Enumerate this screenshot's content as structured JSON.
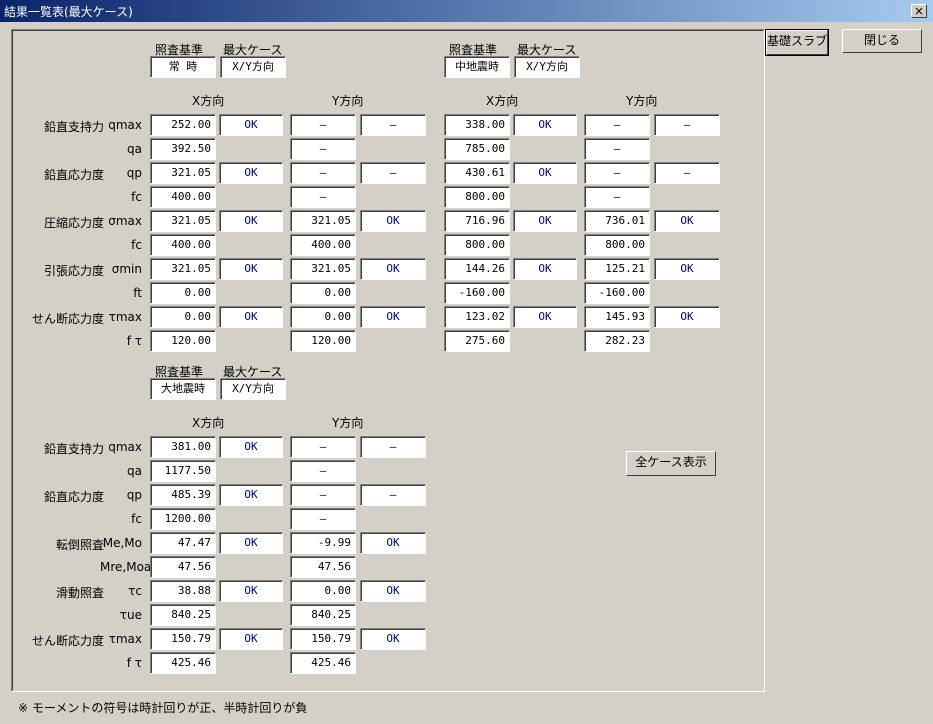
{
  "window": {
    "title": "結果一覧表(最大ケース)",
    "close_glyph": "×"
  },
  "buttons": {
    "slab": "基礎スラブ",
    "close": "閉じる",
    "all_cases": "全ケース表示"
  },
  "headers": {
    "standard": "照査基準",
    "max_case": "最大ケース",
    "x_dir": "X方向",
    "y_dir": "Y方向"
  },
  "group1": {
    "standard": "常 時",
    "max_case": "X/Y方向",
    "rows": [
      {
        "label": "鉛直支持力",
        "sym": "qmax",
        "x": "252.00",
        "xok": "OK",
        "y": "—",
        "yok": "—"
      },
      {
        "sym": "qa",
        "x": "392.50",
        "y": "—"
      },
      {
        "label": "鉛直応力度",
        "sym": "qp",
        "x": "321.05",
        "xok": "OK",
        "y": "—",
        "yok": "—"
      },
      {
        "sym": "fc",
        "x": "400.00",
        "y": "—"
      },
      {
        "label": "圧縮応力度",
        "sym": "σmax",
        "x": "321.05",
        "xok": "OK",
        "y": "321.05",
        "yok": "OK"
      },
      {
        "sym": "fc",
        "x": "400.00",
        "y": "400.00"
      },
      {
        "label": "引張応力度",
        "sym": "σmin",
        "x": "321.05",
        "xok": "OK",
        "y": "321.05",
        "yok": "OK"
      },
      {
        "sym": "ft",
        "x": "0.00",
        "y": "0.00"
      },
      {
        "label": "せん断応力度",
        "sym": "τmax",
        "x": "0.00",
        "xok": "OK",
        "y": "0.00",
        "yok": "OK"
      },
      {
        "sym": "f τ",
        "x": "120.00",
        "y": "120.00"
      }
    ]
  },
  "group2": {
    "standard": "中地震時",
    "max_case": "X/Y方向",
    "rows": [
      {
        "x": "338.00",
        "xok": "OK",
        "y": "—",
        "yok": "—"
      },
      {
        "x": "785.00",
        "y": "—"
      },
      {
        "x": "430.61",
        "xok": "OK",
        "y": "—",
        "yok": "—"
      },
      {
        "x": "800.00",
        "y": "—"
      },
      {
        "x": "716.96",
        "xok": "OK",
        "y": "736.01",
        "yok": "OK"
      },
      {
        "x": "800.00",
        "y": "800.00"
      },
      {
        "x": "144.26",
        "xok": "OK",
        "y": "125.21",
        "yok": "OK"
      },
      {
        "x": "-160.00",
        "y": "-160.00"
      },
      {
        "x": "123.02",
        "xok": "OK",
        "y": "145.93",
        "yok": "OK"
      },
      {
        "x": "275.60",
        "y": "282.23"
      }
    ]
  },
  "group3": {
    "standard": "大地震時",
    "max_case": "X/Y方向",
    "rows": [
      {
        "label": "鉛直支持力",
        "sym": "qmax",
        "x": "381.00",
        "xok": "OK",
        "y": "—",
        "yok": "—"
      },
      {
        "sym": "qa",
        "x": "1177.50",
        "y": "—"
      },
      {
        "label": "鉛直応力度",
        "sym": "qp",
        "x": "485.39",
        "xok": "OK",
        "y": "—",
        "yok": "—"
      },
      {
        "sym": "fc",
        "x": "1200.00",
        "y": "—"
      },
      {
        "label": "転倒照査",
        "sym": "Me,Mo",
        "x": "47.47",
        "xok": "OK",
        "y": "-9.99",
        "yok": "OK"
      },
      {
        "sym": "Mre,Moa",
        "x": "47.56",
        "y": "47.56"
      },
      {
        "label": "滑動照査",
        "sym": "τc",
        "x": "38.88",
        "xok": "OK",
        "y": "0.00",
        "yok": "OK"
      },
      {
        "sym": "τue",
        "x": "840.25",
        "y": "840.25"
      },
      {
        "label": "せん断応力度",
        "sym": "τmax",
        "x": "150.79",
        "xok": "OK",
        "y": "150.79",
        "yok": "OK"
      },
      {
        "sym": "f τ",
        "x": "425.46",
        "y": "425.46"
      }
    ]
  },
  "footer": {
    "note": "※ モーメントの符号は時計回りが正、半時計回りが負"
  }
}
